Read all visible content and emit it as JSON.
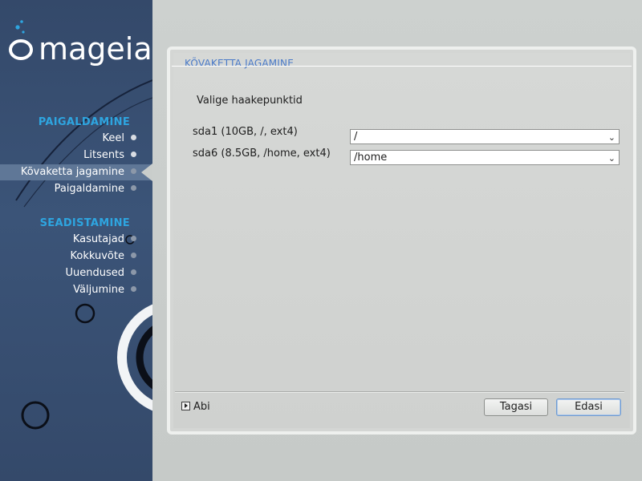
{
  "brand": {
    "name": "mageia",
    "accent_color": "#2ea5e0",
    "sidebar_color": "#3b5478"
  },
  "sidebar": {
    "sections": [
      {
        "title": "PAIGALDAMINE",
        "items": [
          {
            "label": "Keel",
            "state": "done"
          },
          {
            "label": "Litsents",
            "state": "done"
          },
          {
            "label": "Kõvaketta jagamine",
            "state": "active"
          },
          {
            "label": "Paigaldamine",
            "state": "pending"
          }
        ]
      },
      {
        "title": "SEADISTAMINE",
        "items": [
          {
            "label": "Kasutajad",
            "state": "pending"
          },
          {
            "label": "Kokkuvõte",
            "state": "pending"
          },
          {
            "label": "Uuendused",
            "state": "pending"
          },
          {
            "label": "Väljumine",
            "state": "pending"
          }
        ]
      }
    ]
  },
  "panel": {
    "title": "KÕVAKETTA JAGAMINE",
    "subtitle": "Valige haakepunktid",
    "rows": [
      {
        "label": "sda1 (10GB, /, ext4)",
        "value": "/"
      },
      {
        "label": "sda6 (8.5GB, /home, ext4)",
        "value": "/home"
      }
    ]
  },
  "footer": {
    "help_label": "Abi",
    "back_label": "Tagasi",
    "next_label": "Edasi"
  }
}
